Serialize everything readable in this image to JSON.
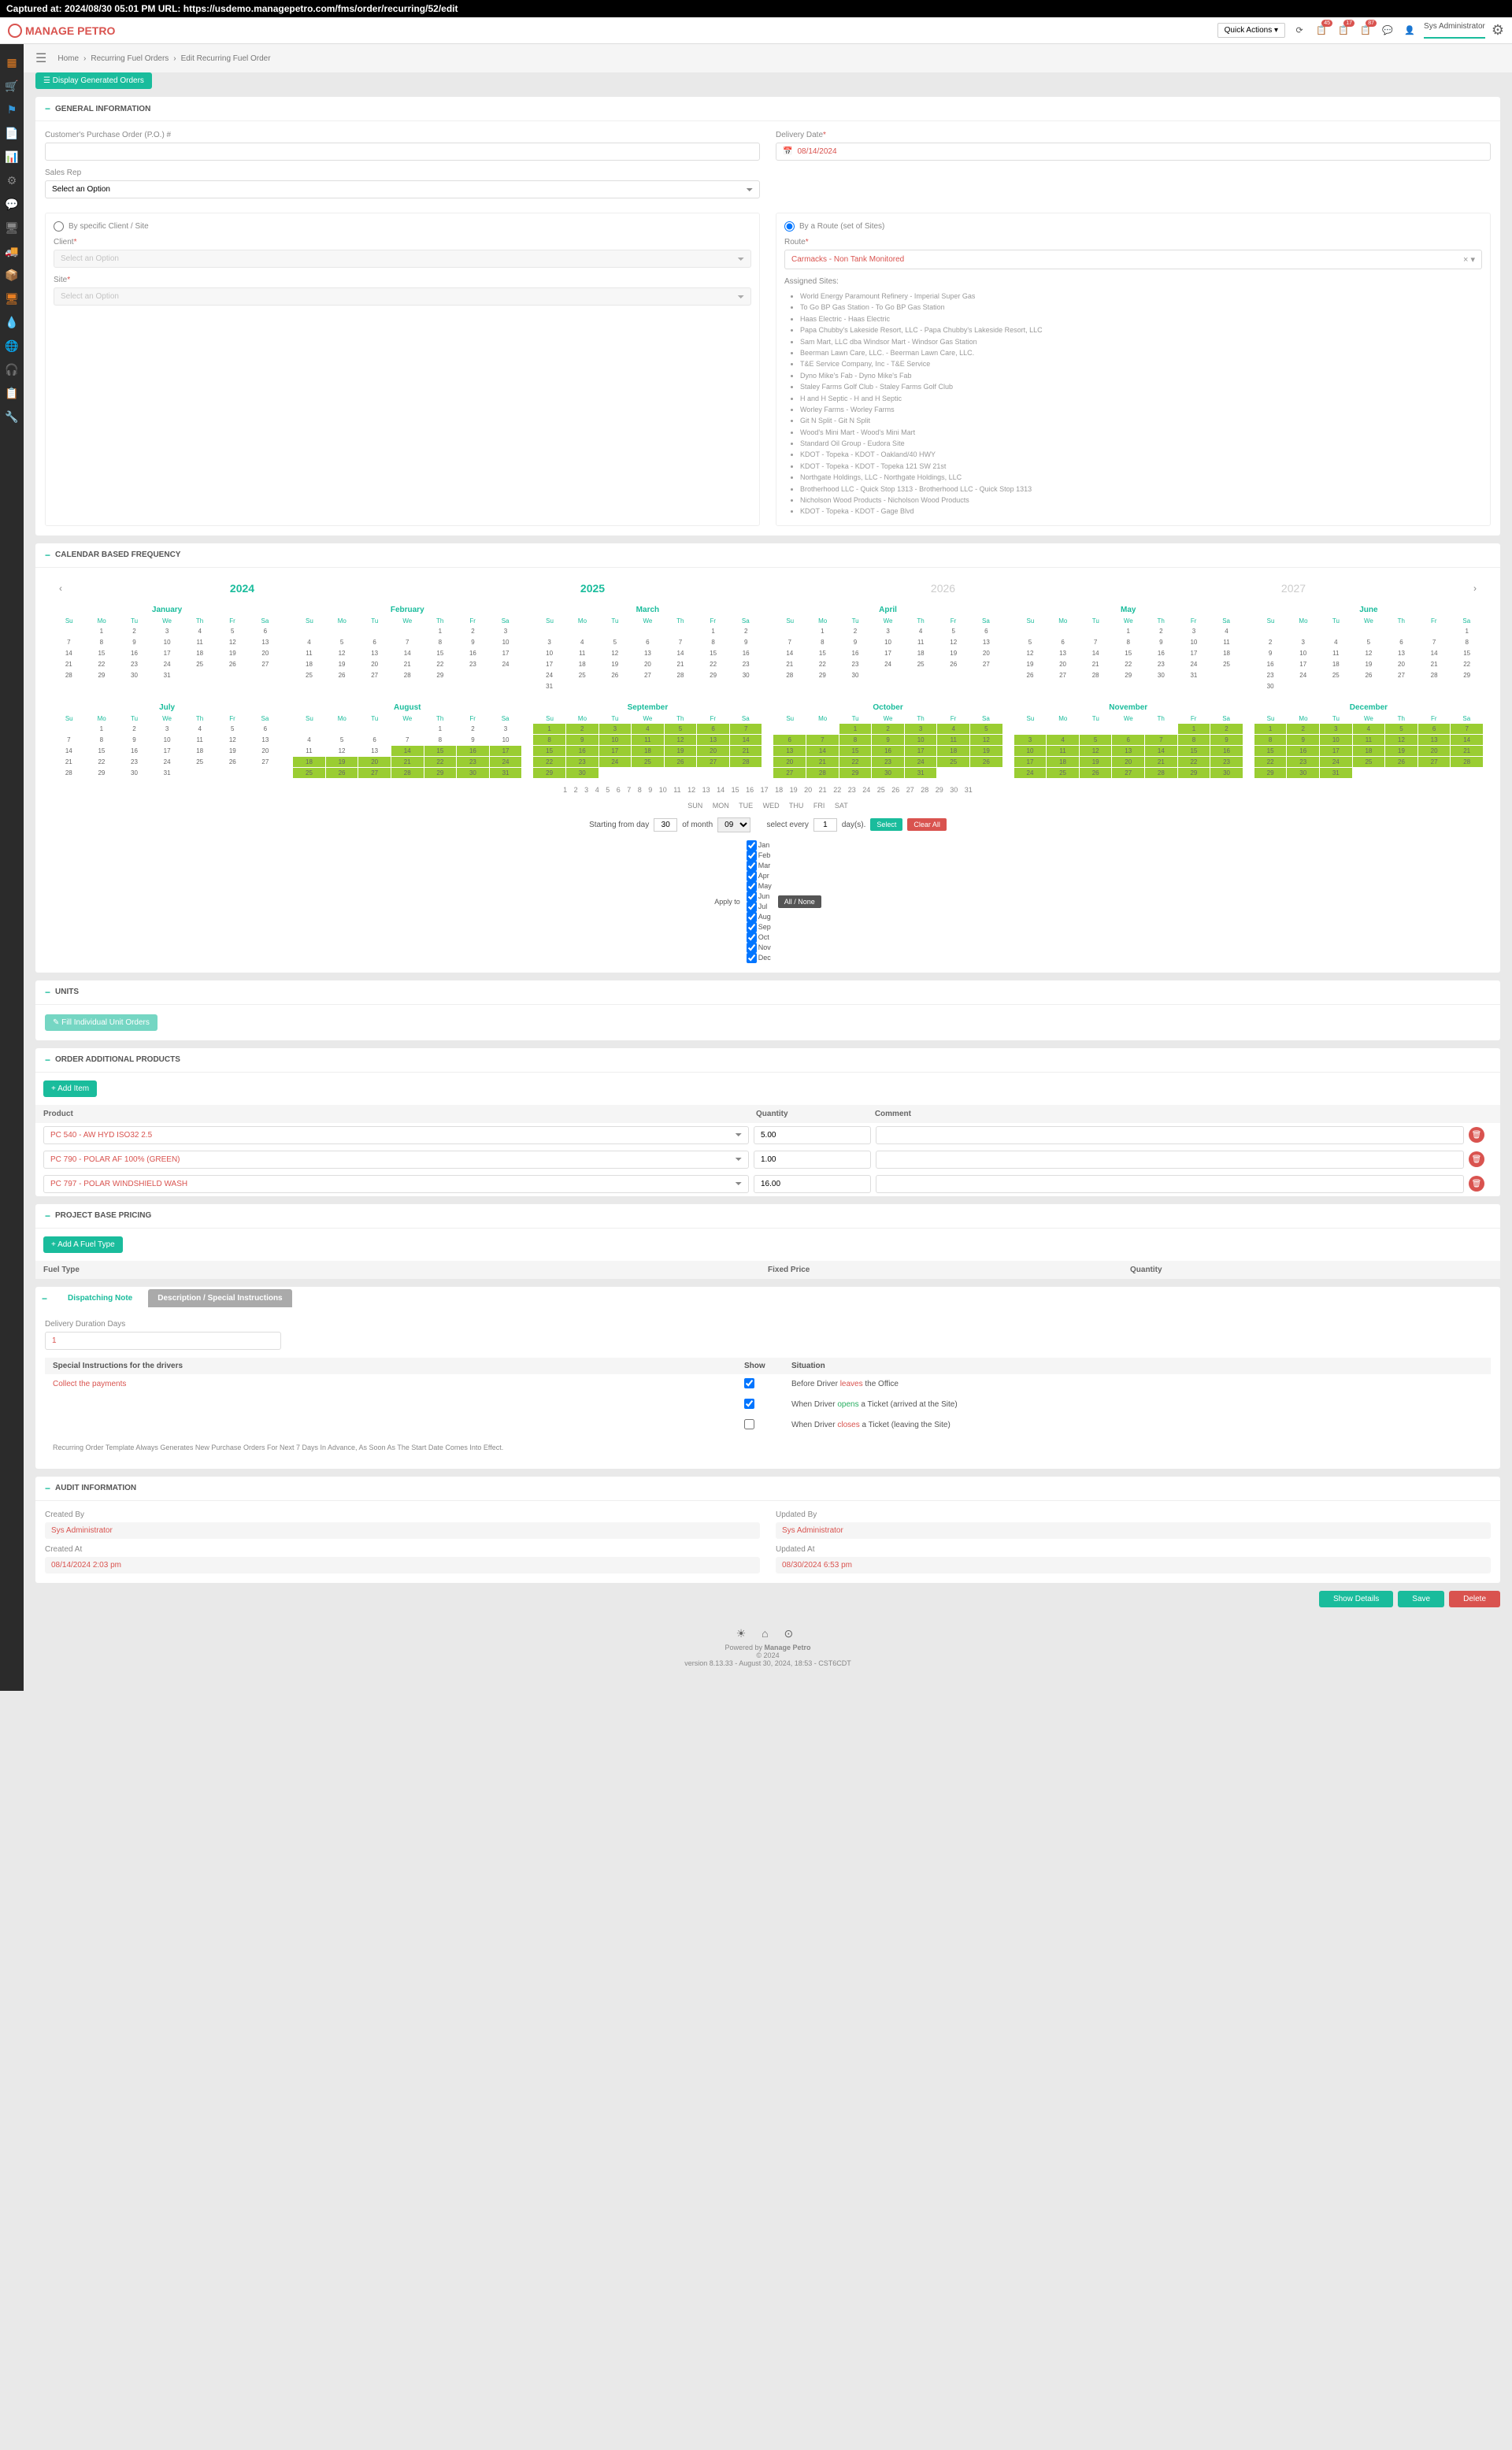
{
  "capture": "Captured at: 2024/08/30 05:01 PM    URL: https://usdemo.managepetro.com/fms/order/recurring/52/edit",
  "logo": "MANAGE PETRO",
  "topbar": {
    "quick_actions": "Quick Actions",
    "user": "Sys Administrator",
    "badges": [
      "45",
      "17",
      "87"
    ]
  },
  "breadcrumb": {
    "home": "Home",
    "recurring": "Recurring Fuel Orders",
    "edit": "Edit Recurring Fuel Order"
  },
  "btn_display": "Display Generated Orders",
  "general": {
    "title": "GENERAL INFORMATION",
    "po_label": "Customer's Purchase Order (P.O.) #",
    "sales_rep": "Sales Rep",
    "select_option": "Select an Option",
    "delivery_date": "Delivery Date",
    "delivery_date_val": "08/14/2024",
    "by_client": "By specific Client / Site",
    "client": "Client",
    "site": "Site",
    "by_route": "By a Route (set of Sites)",
    "route": "Route",
    "route_val": "Carmacks - Non Tank Monitored",
    "assigned_sites": "Assigned Sites:",
    "sites": [
      "World Energy Paramount Refinery - Imperial Super Gas",
      "To Go BP Gas Station - To Go BP Gas Station",
      "Haas Electric - Haas Electric",
      "Papa Chubby's Lakeside Resort, LLC - Papa Chubby's Lakeside Resort, LLC",
      "Sam Mart, LLC dba Windsor Mart - Windsor Gas Station",
      "Beerman Lawn Care, LLC. - Beerman Lawn Care, LLC.",
      "T&E Service Company, Inc - T&E Service",
      "Dyno Mike's Fab - Dyno Mike's Fab",
      "Staley Farms Golf Club - Staley Farms Golf Club",
      "H and H Septic - H and H Septic",
      "Worley Farms - Worley Farms",
      "Git N Split - Git N Split",
      "Wood's Mini Mart - Wood's Mini Mart",
      "Standard Oil Group - Eudora Site",
      "KDOT - Topeka - KDOT - Oakland/40 HWY",
      "KDOT - Topeka - KDOT - Topeka 121 SW 21st",
      "Northgate Holdings, LLC - Northgate Holdings, LLC",
      "Brotherhood LLC - Quick Stop 1313 - Brotherhood LLC - Quick Stop 1313",
      "Nicholson Wood Products - Nicholson Wood Products",
      "KDOT - Topeka - KDOT - Gage Blvd"
    ]
  },
  "calendar": {
    "title": "CALENDAR BASED FREQUENCY",
    "years": [
      "2024",
      "2025",
      "2026",
      "2027"
    ],
    "dow": [
      "Su",
      "Mo",
      "Tu",
      "We",
      "Th",
      "Fr",
      "Sa"
    ],
    "months": [
      {
        "name": "January",
        "start": 1,
        "days": 31,
        "sel": []
      },
      {
        "name": "February",
        "start": 4,
        "days": 29,
        "sel": []
      },
      {
        "name": "March",
        "start": 5,
        "days": 31,
        "sel": []
      },
      {
        "name": "April",
        "start": 1,
        "days": 30,
        "sel": []
      },
      {
        "name": "May",
        "start": 3,
        "days": 31,
        "sel": []
      },
      {
        "name": "June",
        "start": 6,
        "days": 30,
        "sel": []
      },
      {
        "name": "July",
        "start": 1,
        "days": 31,
        "sel": []
      },
      {
        "name": "August",
        "start": 4,
        "days": 31,
        "sel": [
          14,
          15,
          16,
          17,
          18,
          19,
          20,
          21,
          22,
          23,
          24,
          25,
          26,
          27,
          28,
          29,
          30,
          31
        ]
      },
      {
        "name": "September",
        "start": 0,
        "days": 30,
        "sel": [
          1,
          2,
          3,
          4,
          5,
          6,
          7,
          8,
          9,
          10,
          11,
          12,
          13,
          14,
          15,
          16,
          17,
          18,
          19,
          20,
          21,
          22,
          23,
          24,
          25,
          26,
          27,
          28,
          29,
          30
        ]
      },
      {
        "name": "October",
        "start": 2,
        "days": 31,
        "sel": [
          1,
          2,
          3,
          4,
          5,
          6,
          7,
          8,
          9,
          10,
          11,
          12,
          13,
          14,
          15,
          16,
          17,
          18,
          19,
          20,
          21,
          22,
          23,
          24,
          25,
          26,
          27,
          28,
          29,
          30,
          31
        ]
      },
      {
        "name": "November",
        "start": 5,
        "days": 30,
        "sel": [
          1,
          2,
          3,
          4,
          5,
          6,
          7,
          8,
          9,
          10,
          11,
          12,
          13,
          14,
          15,
          16,
          17,
          18,
          19,
          20,
          21,
          22,
          23,
          24,
          25,
          26,
          27,
          28,
          29,
          30
        ]
      },
      {
        "name": "December",
        "start": 0,
        "days": 31,
        "sel": [
          1,
          2,
          3,
          4,
          5,
          6,
          7,
          8,
          9,
          10,
          11,
          12,
          13,
          14,
          15,
          16,
          17,
          18,
          19,
          20,
          21,
          22,
          23,
          24,
          25,
          26,
          27,
          28,
          29,
          30,
          31
        ]
      }
    ],
    "day_numbers": "1  2  3  4  5  6  7  8  9  10  11  12  13  14  15  16  17  18  19  20  21  22  23  24  25  26  27  28  29  30  31",
    "dow_labels": "SUN  MON  TUE  WED  THU  FRI  SAT",
    "starting_from": "Starting from day",
    "start_day": "30",
    "of_month": "of month",
    "month_sel": "09",
    "select_every": "select every",
    "every_val": "1",
    "days_label": "day(s).",
    "btn_select": "Select",
    "btn_clear": "Clear All",
    "apply_to": "Apply to",
    "month_abbr": [
      "Jan",
      "Feb",
      "Mar",
      "Apr",
      "May",
      "Jun",
      "Jul",
      "Aug",
      "Sep",
      "Oct",
      "Nov",
      "Dec"
    ],
    "all_none": "All / None"
  },
  "units": {
    "title": "UNITS",
    "btn": "Fill Individual Unit Orders"
  },
  "order_products": {
    "title": "ORDER ADDITIONAL PRODUCTS",
    "add_item": "Add Item",
    "th_product": "Product",
    "th_qty": "Quantity",
    "th_comment": "Comment",
    "rows": [
      {
        "product": "PC 540 - AW HYD ISO32 2.5",
        "qty": "5.00"
      },
      {
        "product": "PC 790 - POLAR AF 100% (GREEN)",
        "qty": "1.00"
      },
      {
        "product": "PC 797 - POLAR WINDSHIELD WASH",
        "qty": "16.00"
      }
    ]
  },
  "pricing": {
    "title": "PROJECT BASE PRICING",
    "add_fuel": "Add A Fuel Type",
    "th_fuel": "Fuel Type",
    "th_fixed": "Fixed Price",
    "th_qty": "Quantity"
  },
  "dispatch": {
    "tab1": "Dispatching Note",
    "tab2": "Description / Special Instructions",
    "duration": "Delivery Duration Days",
    "duration_val": "1",
    "instr_label": "Special Instructions for the drivers",
    "instr_val": "Collect the payments",
    "show": "Show",
    "situation": "Situation",
    "sit1a": "Before Driver ",
    "sit1b": "leaves",
    "sit1c": " the Office",
    "sit2a": "When Driver ",
    "sit2b": "opens",
    "sit2c": " a Ticket (arrived at the Site)",
    "sit3a": "When Driver ",
    "sit3b": "closes",
    "sit3c": " a Ticket (leaving the Site)",
    "note": "Recurring Order Template Always Generates New Purchase Orders For Next 7 Days In Advance, As Soon As The Start Date Comes Into Effect."
  },
  "audit": {
    "title": "AUDIT INFORMATION",
    "created_by": "Created By",
    "created_by_val": "Sys Administrator",
    "created_at": "Created At",
    "created_at_val": "08/14/2024 2:03 pm",
    "updated_by": "Updated By",
    "updated_by_val": "Sys Administrator",
    "updated_at": "Updated At",
    "updated_at_val": "08/30/2024 6:53 pm"
  },
  "actions": {
    "details": "Show Details",
    "save": "Save",
    "delete": "Delete"
  },
  "footer": {
    "powered": "Powered by ",
    "mp": "Manage Petro",
    "copyright": "© 2024",
    "version": "version 8.13.33 - August 30, 2024, 18:53 - CST6CDT"
  }
}
